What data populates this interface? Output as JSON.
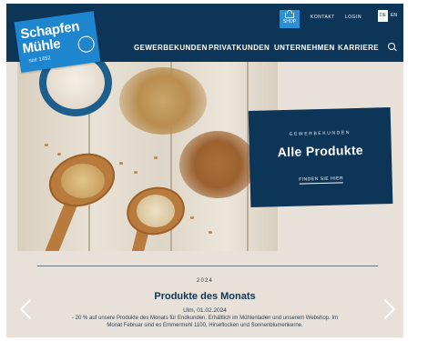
{
  "brand": {
    "name_line1": "Schapfen",
    "name_line2": "Mühle",
    "since": "seit 1452"
  },
  "utility_nav": {
    "shop_label": "SHOP",
    "kontakt": "KONTAKT",
    "login": "LOGIN",
    "lang_de": "DE",
    "lang_en": "EN"
  },
  "main_nav": {
    "items": [
      "GEWERBEKUNDEN",
      "PRIVATKUNDEN",
      "UNTERNEHMEN",
      "KARRIERE"
    ],
    "search_icon": "search-icon"
  },
  "hero": {
    "image_description_icon": "grain-photo",
    "cta": {
      "eyebrow": "GEWERBEKUNDEN",
      "title": "Alle Produkte",
      "link": "FINDEN SIE HIER"
    }
  },
  "products_of_month": {
    "year": "2024",
    "title": "Produkte des Monats",
    "date": "Ulm, 01.02.2024",
    "line1": "- 20 % auf unsere Produkte des Monats für Endkunden. Erhältlich im Mühlenladen und unserem Webshop. Im",
    "line2": "Monat Februar sind es Emmermehl 1100, Hirseflocken und Sonnenblumenkerne."
  },
  "colors": {
    "navy": "#0d3558",
    "brand_blue": "#1d86cf",
    "background": "#e7e1d9"
  }
}
